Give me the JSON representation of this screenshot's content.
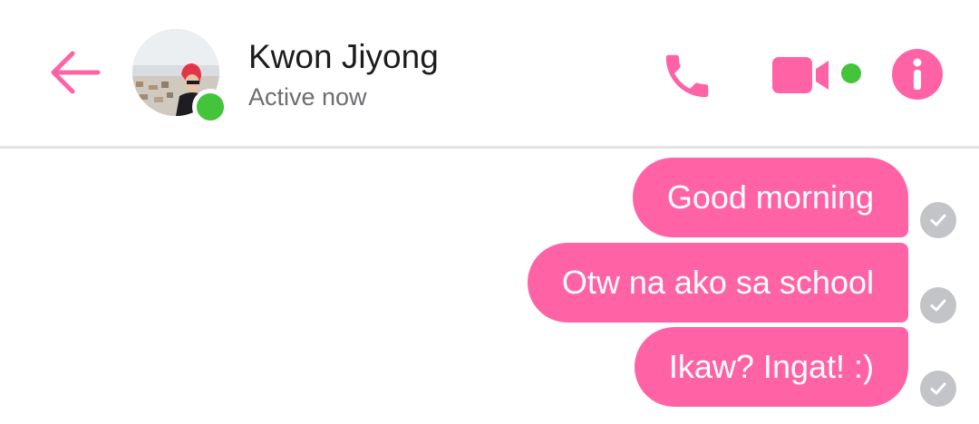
{
  "header": {
    "contact_name": "Kwon Jiyong",
    "status": "Active now",
    "back_icon": "arrow-left-icon",
    "call_icon": "phone-icon",
    "video_icon": "video-camera-icon",
    "info_icon": "info-icon"
  },
  "messages": [
    {
      "text": "Good morning",
      "status_icon": "delivered-check-icon"
    },
    {
      "text": "Otw na ako sa school",
      "status_icon": "delivered-check-icon"
    },
    {
      "text": "Ikaw? Ingat! :)",
      "status_icon": "delivered-check-icon"
    }
  ],
  "colors": {
    "accent": "#ff63a5",
    "online": "#44c43a",
    "check": "#c2c4c8",
    "divider": "#e3e3e6"
  }
}
